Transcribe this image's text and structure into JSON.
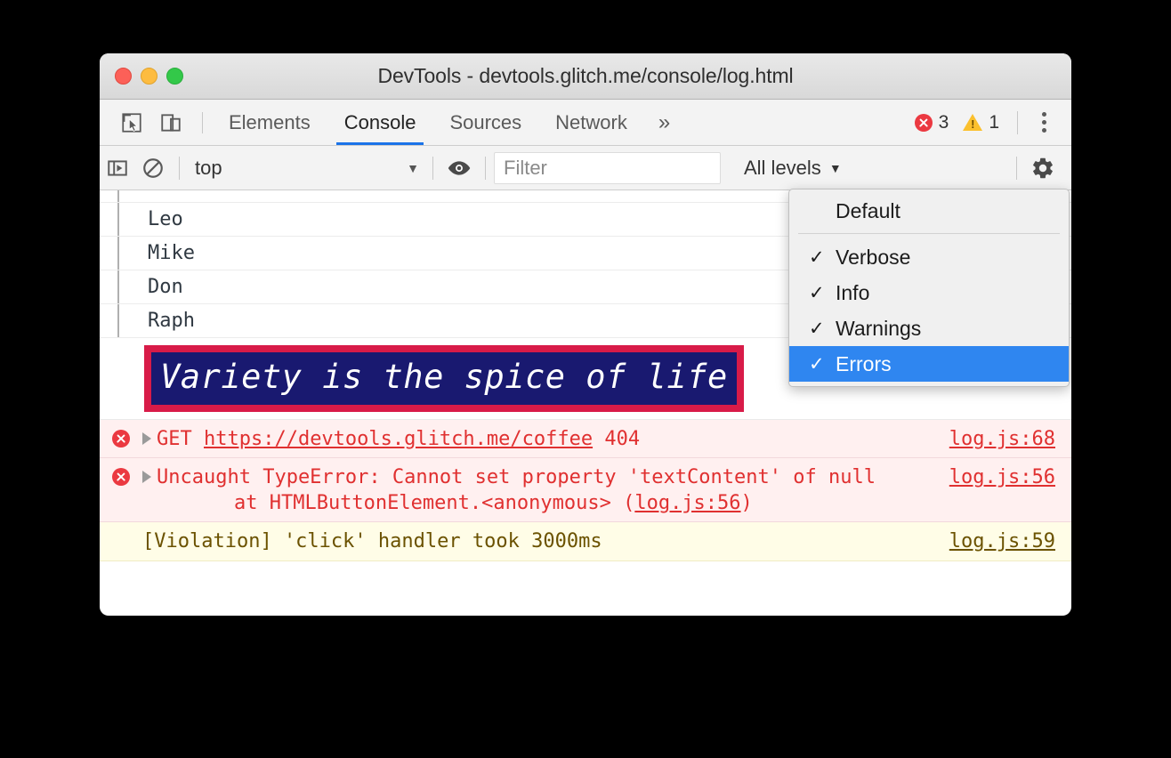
{
  "window": {
    "title": "DevTools - devtools.glitch.me/console/log.html",
    "traffic_lights": [
      "close",
      "minimize",
      "zoom"
    ]
  },
  "devtools_tabbar": {
    "icons": [
      "inspect-element-icon",
      "device-toolbar-icon"
    ],
    "tabs": [
      {
        "label": "Elements",
        "active": false
      },
      {
        "label": "Console",
        "active": true
      },
      {
        "label": "Sources",
        "active": false
      },
      {
        "label": "Network",
        "active": false
      }
    ],
    "more_tabs_label": "»",
    "error_count": "3",
    "warning_count": "1",
    "menu_label": "⋮"
  },
  "filterbar": {
    "sidebar_toggle_icon": "console-sidebar-icon",
    "clear_console_icon": "clear-console-icon",
    "context": {
      "value": "top",
      "caret": "▼"
    },
    "eye_icon": "live-expression-eye-icon",
    "filter": {
      "placeholder": "Filter",
      "value": ""
    },
    "levels": {
      "label": "All levels",
      "caret": "▼"
    },
    "settings_icon": "gear-icon"
  },
  "levels_menu": {
    "default_item": "Default",
    "items": [
      {
        "label": "Verbose",
        "checked": true,
        "selected": false,
        "check": "✓"
      },
      {
        "label": "Info",
        "checked": true,
        "selected": false,
        "check": "✓"
      },
      {
        "label": "Warnings",
        "checked": true,
        "selected": false,
        "check": "✓"
      },
      {
        "label": "Errors",
        "checked": true,
        "selected": true,
        "check": "✓"
      }
    ]
  },
  "console": {
    "group_rows": [
      {
        "label": "Leo"
      },
      {
        "label": "Mike"
      },
      {
        "label": "Don"
      },
      {
        "label": "Raph"
      }
    ],
    "styled_banner": {
      "text": "Variety is the spice of life",
      "border_color": "#d81b48",
      "background_color": "#191970",
      "text_color": "#ffffff"
    },
    "messages": [
      {
        "level": "error",
        "icon": "error-icon",
        "arrow": "disclosure-triangle",
        "text_plain": "GET https://devtools.glitch.me/coffee 404",
        "prefix": "GET ",
        "link": "https://devtools.glitch.me/coffee",
        "suffix": " 404",
        "source": "log.js:68"
      },
      {
        "level": "error",
        "icon": "error-icon",
        "arrow": "disclosure-triangle",
        "text_plain": "Uncaught TypeError: Cannot set property 'textContent' of null",
        "stack_prefix": "    at HTMLButtonElement.<anonymous> (",
        "stack_link": "log.js:56",
        "stack_suffix": ")",
        "source": "log.js:56"
      },
      {
        "level": "warning",
        "icon": "",
        "text_plain": "[Violation] 'click' handler took 3000ms",
        "source": "log.js:59"
      }
    ],
    "prompt_chevron": "›"
  },
  "colors": {
    "accent_blue": "#1a73e8",
    "menu_highlight": "#2f86f0",
    "error_red": "#e03030",
    "error_bg": "#fff0f0",
    "warning_bg": "#fffde7",
    "warning_text": "#6b5200",
    "banner_border": "#d81b48",
    "banner_bg": "#191970"
  }
}
